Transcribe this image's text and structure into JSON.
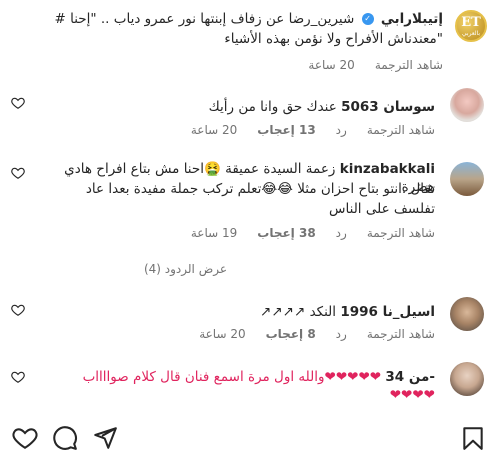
{
  "post": {
    "username": "إتيبلارابي",
    "caption_line1": "شيرين_رضا عن زفاف إبنتها نور عمرو دياب .. \"إحنا #",
    "caption_line2": "\"معندناش الأفراح ولا نؤمن بهذه الأشياء",
    "time": "20 ساعة",
    "see_translation": "شاهد الترجمة",
    "logo_text": "ET",
    "logo_sub": "بالعربي"
  },
  "comments": [
    {
      "username": "سوسان 5063",
      "text": "عندك حق وانا من رأيك",
      "time": "20 ساعة",
      "likes": "13 إعجاب",
      "reply": "رد",
      "see_translation": "شاهد الترجمة"
    },
    {
      "username": "kinzabakkali",
      "line1": "زعمة السيدة عميقة 🤮احنا مش بتاع افراح هادي هضرة",
      "line2": "تقال .انتو بتاح احزان مثلا 😂😂تعلم تركب جملة مفيدة بعدا عاد",
      "line3": "تفلسف على الناس",
      "time": "19 ساعة",
      "likes": "38 إعجاب",
      "reply": "رد",
      "see_translation": "شاهد الترجمة",
      "view_replies": "عرض الردود (4)"
    },
    {
      "username": "اسيل_نا 1996",
      "text": "النكد ↗↗↗↗",
      "time": "20 ساعة",
      "likes": "8 إعجاب",
      "reply": "رد",
      "see_translation": "شاهد الترجمة"
    },
    {
      "username": "من 34-",
      "line1": "❤❤❤❤❤والله اول مرة اسمع فنان قال كلام صوااااب",
      "line2": "❤❤❤❤"
    }
  ],
  "icons": {
    "like": "heart-icon",
    "comment": "comment-icon",
    "share": "send-icon",
    "save": "bookmark-icon"
  },
  "colors": {
    "verified": "#3897f0",
    "secondary_text": "#737373",
    "heart_red": "#e0245e",
    "logo_gold": "#c9a227"
  }
}
